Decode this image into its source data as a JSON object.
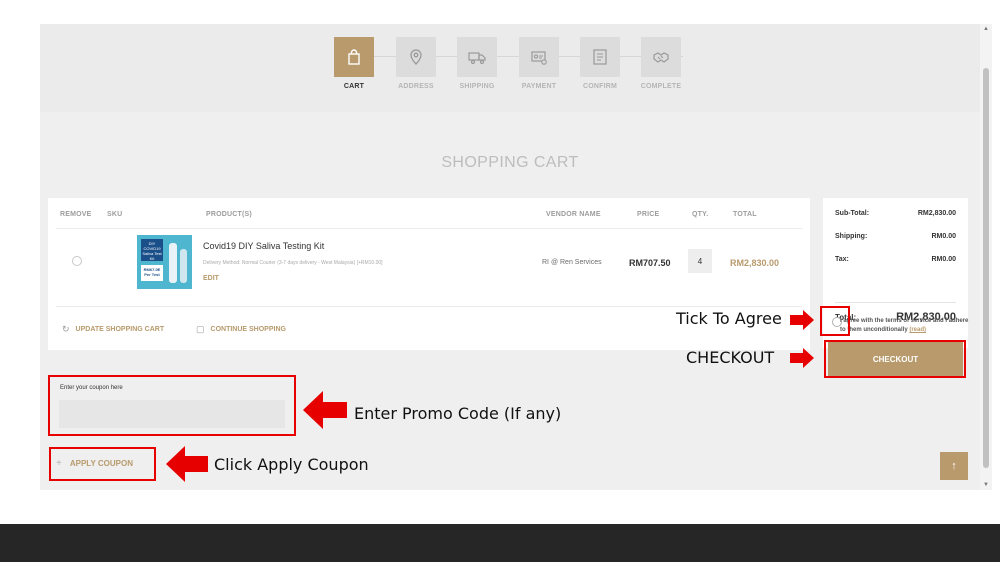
{
  "steps": [
    {
      "label": "CART",
      "icon": "bag-icon",
      "active": true
    },
    {
      "label": "ADDRESS",
      "icon": "map-pin-icon",
      "active": false
    },
    {
      "label": "SHIPPING",
      "icon": "truck-icon",
      "active": false
    },
    {
      "label": "PAYMENT",
      "icon": "payment-icon",
      "active": false
    },
    {
      "label": "CONFIRM",
      "icon": "confirm-icon",
      "active": false
    },
    {
      "label": "COMPLETE",
      "icon": "handshake-icon",
      "active": false
    }
  ],
  "cart": {
    "title": "SHOPPING CART",
    "columns": {
      "remove": "REMOVE",
      "sku": "SKU",
      "product": "PRODUCT(S)",
      "vendor": "VENDOR NAME",
      "price": "PRICE",
      "qty": "QTY.",
      "total": "TOTAL"
    },
    "item": {
      "name": "Covid19 DIY Saliva Testing Kit",
      "delivery": "Delivery Method: Normal Courier (3-7 days delivery - West Malaysia) [+RM10.00]",
      "edit": "EDIT",
      "vendor": "RI @ Ren Services",
      "price": "RM707.50",
      "qty": "4",
      "total": "RM2,830.00",
      "thumb_text": {
        "kit": "DIY COVID19 Saliva Test Kit",
        "price": "RM67.0E Per Test"
      }
    },
    "update_label": "UPDATE SHOPPING CART",
    "continue_label": "CONTINUE SHOPPING"
  },
  "coupon": {
    "label": "Enter your coupon here",
    "value": "",
    "placeholder": "",
    "apply_label": "APPLY COUPON"
  },
  "summary": {
    "subtotal_label": "Sub-Total:",
    "subtotal_value": "RM2,830.00",
    "shipping_label": "Shipping:",
    "shipping_value": "RM0.00",
    "tax_label": "Tax:",
    "tax_value": "RM0.00",
    "total_label": "Total:",
    "total_value": "RM2,830.00",
    "agree_text": "I agree with the terms of service and I adhere to them unconditionally",
    "agree_link": "(read)",
    "checkout_label": "CHECKOUT"
  },
  "annotations": {
    "tick": "Tick To Agree",
    "checkout": "CHECKOUT",
    "promo": "Enter Promo Code (If any)",
    "apply": "Click Apply Coupon"
  },
  "colors": {
    "accent": "#b89a6c",
    "annotation_red": "#e60000"
  }
}
